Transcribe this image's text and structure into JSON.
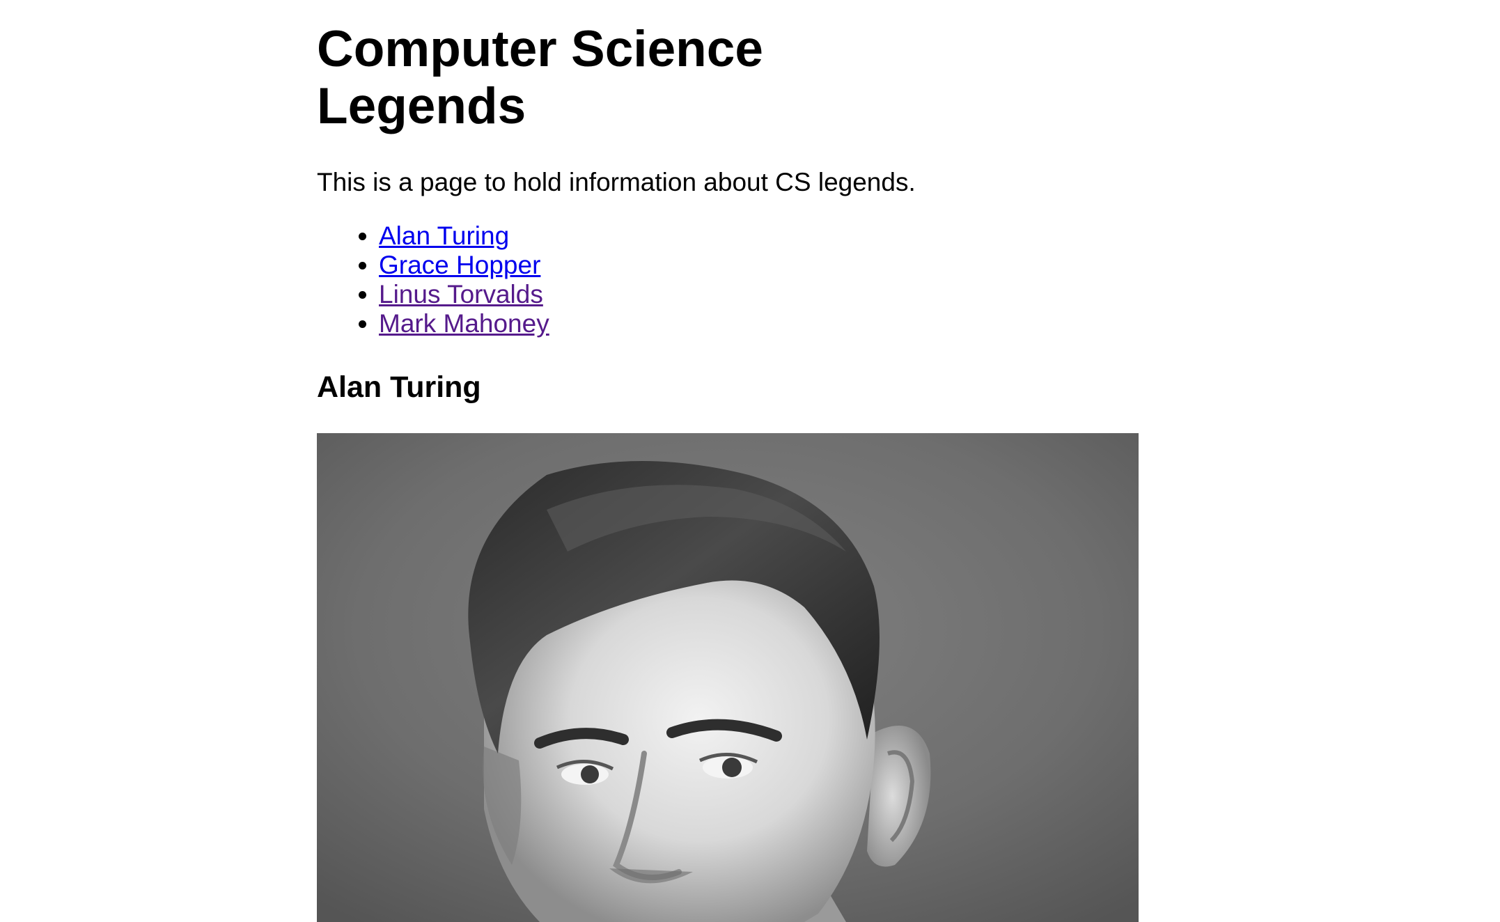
{
  "page": {
    "title": "Computer Science Legends",
    "intro": "This is a page to hold information about CS legends."
  },
  "nav": {
    "links": [
      {
        "label": "Alan Turing",
        "state": "unvisited"
      },
      {
        "label": "Grace Hopper",
        "state": "unvisited"
      },
      {
        "label": "Linus Torvalds",
        "state": "visited"
      },
      {
        "label": "Mark Mahoney",
        "state": "visited"
      }
    ]
  },
  "sections": [
    {
      "heading": "Alan Turing",
      "image": {
        "kind": "black-and-white portrait photograph"
      }
    }
  ],
  "colors": {
    "link": "#0000ee",
    "visited_link": "#551a8b",
    "text": "#000000",
    "background": "#ffffff"
  }
}
